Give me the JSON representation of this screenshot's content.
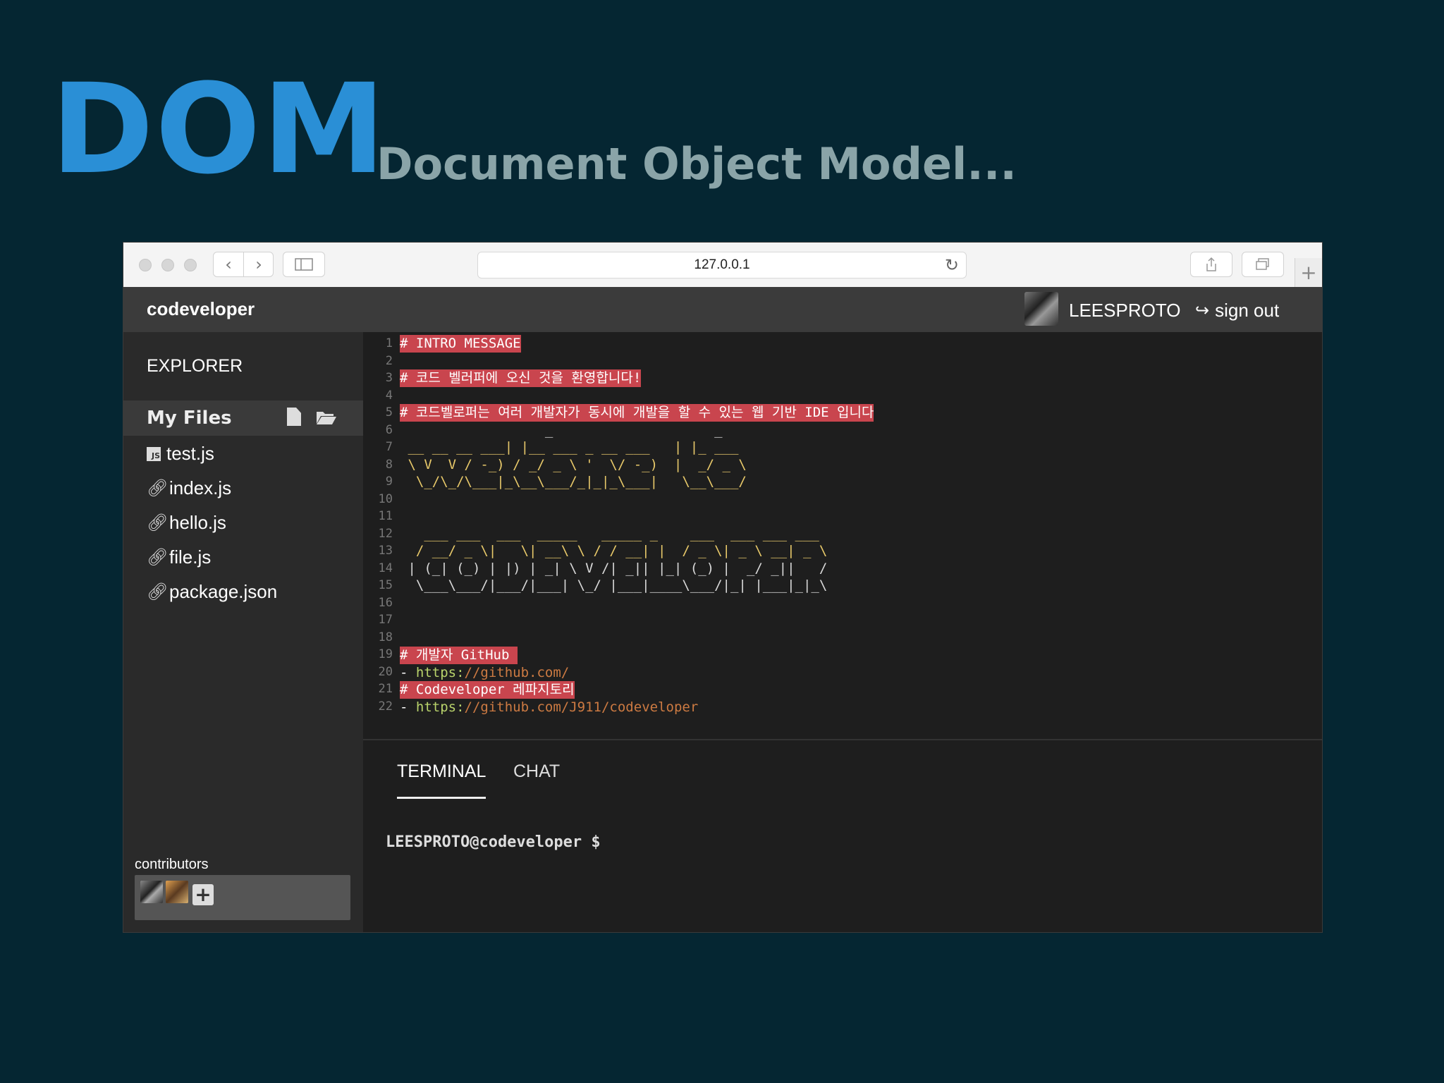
{
  "slide": {
    "title": "DOM",
    "subtitle": "Document Object Model..."
  },
  "browser": {
    "url": "127.0.0.1"
  },
  "app": {
    "brand": "codeveloper",
    "username": "LEESPROTO",
    "signout_label": "sign out"
  },
  "sidebar": {
    "explorer_label": "EXPLORER",
    "section_label": "My Files",
    "files": [
      {
        "name": "test.js",
        "icon": "js-file-icon"
      },
      {
        "name": "index.js",
        "icon": "link-icon"
      },
      {
        "name": "hello.js",
        "icon": "link-icon"
      },
      {
        "name": "file.js",
        "icon": "link-icon"
      },
      {
        "name": "package.json",
        "icon": "link-icon"
      }
    ],
    "contributors_label": "contributors"
  },
  "editor": {
    "line_numbers": [
      "1",
      "2",
      "3",
      "4",
      "5",
      "6",
      "7",
      "8",
      "9",
      "10",
      "11",
      "12",
      "13",
      "14",
      "15",
      "16",
      "17",
      "18",
      "19",
      "20",
      "21",
      "22"
    ],
    "lines": {
      "l1": "# INTRO MESSAGE",
      "l3": "# 코드 벨러퍼에 오신 것을 환영합니다!",
      "l5": "# 코드벨로퍼는 여러 개발자가 동시에 개발을 할 수 있는 웹 기반 IDE 입니다",
      "l19": "# 개발자 GitHub ",
      "l20_dash": "- ",
      "l20_proto": "https:",
      "l20_url": "//github.com/",
      "l21": "# Codeveloper 레파지토리",
      "l22_dash": "- ",
      "l22_proto": "https:",
      "l22_url": "//github.com/J911/codeveloper"
    },
    "ascii_art": {
      "a6": "                  _                    _",
      "a7": " __ __ __ ___| |__ ___ _ __ ___   | |_ ___",
      "a8": " \\ V  V / -_) / _/ _ \\ '  \\/ -_)  |  _/ _ \\",
      "a9": "  \\_/\\_/\\___|_\\__\\___/_|_|_\\___|   \\__\\___/",
      "a12": "   ___ ___  ___  _____   _____ _    ___  ___ ___ ___",
      "a13": "  / __/ _ \\|   \\| __\\ \\ / / __| |  / _ \\| _ \\ __| _ \\",
      "a14": " | (_| (_) | |) | _| \\ V /| _|| |_| (_) |  _/ _||   /",
      "a15": "  \\___\\___/|___/|___| \\_/ |___|____\\___/|_| |___|_|_\\"
    }
  },
  "bottom_panel": {
    "tabs": [
      "TERMINAL",
      "CHAT"
    ],
    "active_tab": "TERMINAL",
    "prompt": "LEESPROTO@codeveloper $"
  },
  "colors": {
    "background": "#052632",
    "title_blue": "#2a8fd6",
    "highlight_red": "#c9454e",
    "protocol_green": "#b9d36b",
    "url_orange": "#cc7a42"
  }
}
